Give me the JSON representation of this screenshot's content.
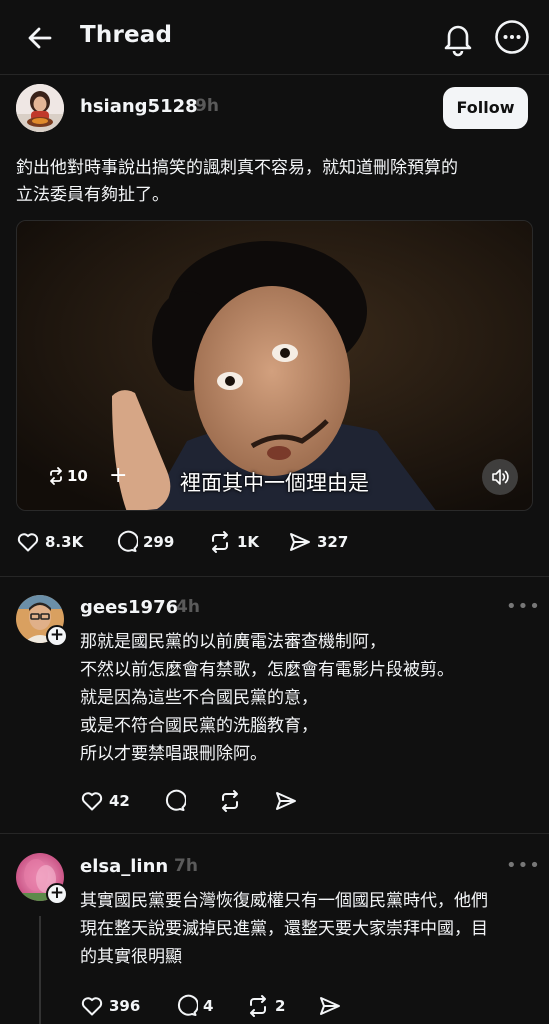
{
  "header": {
    "title": "Thread"
  },
  "post": {
    "username": "hsiang5128",
    "time": "9h",
    "follow_label": "Follow",
    "text_line1": "釣出他對時事說出搞笑的諷刺真不容易，就知道刪除預算的",
    "text_line2": "立法委員有夠扯了。",
    "video": {
      "subtitle": "裡面其中一個理由是",
      "reposts": "10"
    },
    "likes": "8.3K",
    "replies": "299",
    "reposts": "1K",
    "shares": "327"
  },
  "replies": [
    {
      "username": "gees1976",
      "time": "4h",
      "lines": [
        "那就是國民黨的以前廣電法審查機制阿，",
        "不然以前怎麼會有禁歌，怎麼會有電影片段被剪。",
        "就是因為這些不合國民黨的意，",
        "或是不符合國民黨的洗腦教育，",
        "所以才要禁唱跟刪除阿。"
      ],
      "likes": "42"
    },
    {
      "username": "elsa_linn",
      "time": "7h",
      "lines": [
        "其實國民黨要台灣恢復威權只有一個國民黨時代，他們",
        "現在整天說要滅掉民進黨，還整天要大家崇拜中國，目",
        "的其實很明顯"
      ],
      "likes": "396",
      "replies": "4",
      "reposts": "2"
    }
  ]
}
